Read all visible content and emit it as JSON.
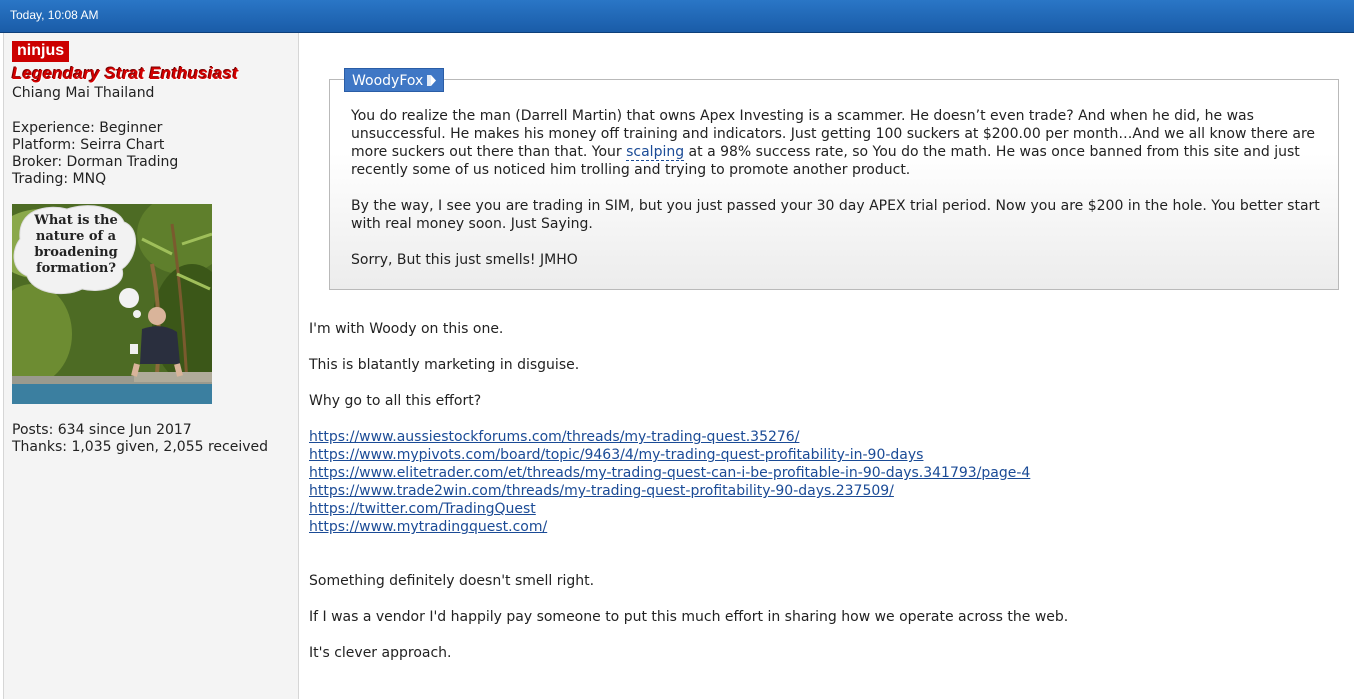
{
  "post": {
    "date": "Today, 10:08 AM"
  },
  "user": {
    "name": "ninjus",
    "title": "Legendary Strat Enthusiast",
    "location": "Chiang Mai Thailand",
    "experience": "Experience: Beginner",
    "platform": "Platform: Seirra Chart",
    "broker": "Broker: Dorman Trading",
    "trading": "Trading: MNQ",
    "avatar_caption": [
      "What is the",
      "nature of a",
      "broadening",
      "formation?"
    ],
    "posts": "Posts: 634 since Jun 2017",
    "thanks": "Thanks: 1,035 given, 2,055 received"
  },
  "quote": {
    "author": "WoodyFox",
    "p1_before": "You do realize the man (Darrell Martin) that owns Apex Investing is a scammer. He doesn’t even trade? And when he did, he was unsuccessful. He makes his money off training and indicators. Just getting 100 suckers at $200.00 per month…And we all know there are more suckers out there than that. Your ",
    "p1_link": "scalping",
    "p1_after": " at a 98% success rate, so You do the math. He was once banned from this site and just recently some of us noticed him trolling and trying to promote another product.",
    "p2": "By the way, I see you are trading in SIM, but you just passed your 30 day APEX trial period. Now you are $200 in the hole. You better start with real money soon. Just Saying.",
    "p3": "Sorry, But this just smells! JMHO"
  },
  "body": {
    "p1": "I'm with Woody on this one.",
    "p2": "This is blatantly marketing in disguise.",
    "p3": "Why go to all this effort?",
    "links": [
      "https://www.aussiestockforums.com/threads/my-trading-quest.35276/",
      "https://www.mypivots.com/board/topic/9463/4/my-trading-quest-profitability-in-90-days",
      "https://www.elitetrader.com/et/threads/my-trading-quest-can-i-be-profitable-in-90-days.341793/page-4",
      "https://www.trade2win.com/threads/my-trading-quest-profitability-90-days.237509/",
      "https://twitter.com/TradingQuest",
      "https://www.mytradingquest.com/"
    ],
    "p4": "Something definitely doesn't smell right.",
    "p5": "If I was a vendor I'd happily pay someone to put this much effort in sharing how we operate across the web.",
    "p6": "It's clever approach."
  },
  "colors": {
    "header_bar": "#1a5ca8",
    "username_bg": "#cc0000",
    "title_text": "#d40000",
    "quote_tab": "#3f77c5",
    "link": "#1b4b96"
  },
  "icons": [
    "quote-jump-arrow-icon"
  ]
}
